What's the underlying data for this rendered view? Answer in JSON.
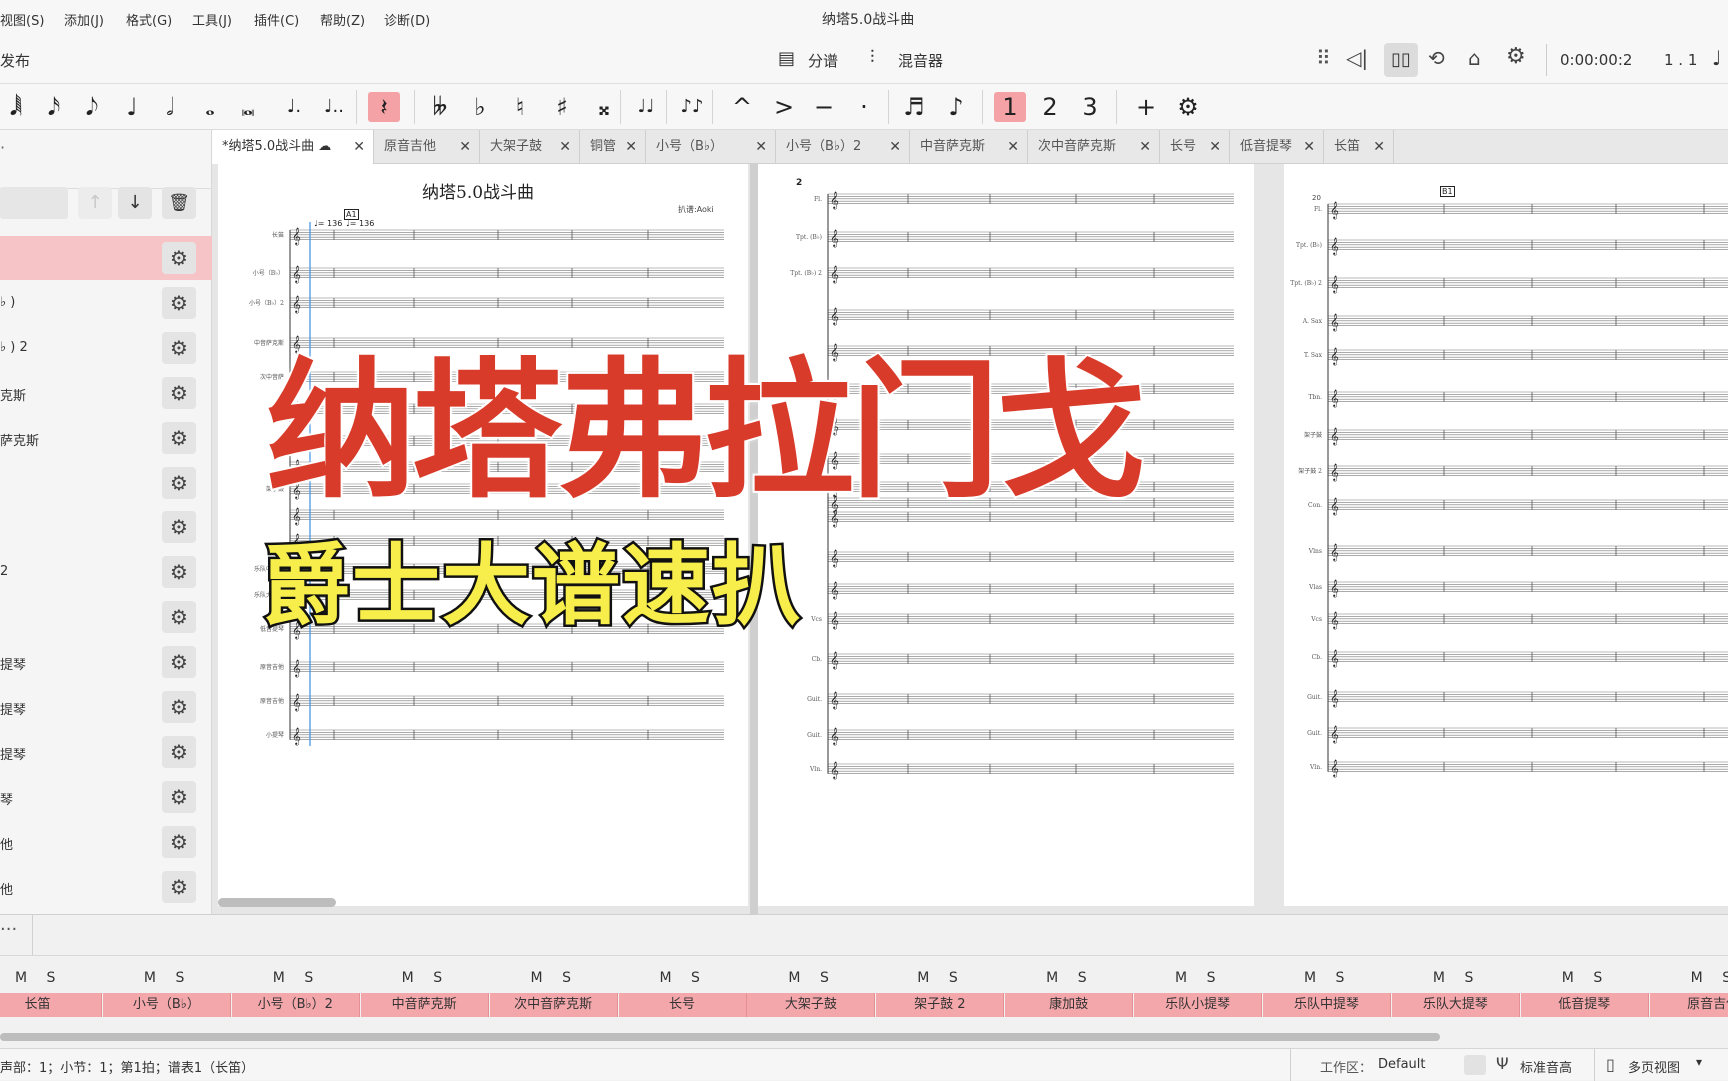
{
  "menu": [
    "视图(S)",
    "添加(J)",
    "格式(G)",
    "工具(J)",
    "插件(C)",
    "帮助(Z)",
    "诊断(D)"
  ],
  "window_title": "纳塔5.0战斗曲",
  "topbar": {
    "publish": "发布",
    "parts_label": "分谱",
    "mixer_label": "混音器",
    "time": "0:00:00:2",
    "position": "1 . 1"
  },
  "toolbar_icons": [
    "sixtyfourth-note-icon",
    "sixteenth-note-icon",
    "eighth-note-icon",
    "quarter-note-icon",
    "half-note-icon",
    "whole-note-icon",
    "breve-icon",
    "dotted-note-icon",
    "double-dotted-note-icon",
    "rest-icon",
    "double-flat-icon",
    "flat-icon",
    "natural-icon",
    "sharp-icon",
    "double-sharp-icon",
    "tie-icon",
    "slur-icon",
    "marcato-icon",
    "accent-icon",
    "tenuto-icon",
    "staccato-icon",
    "tuplet-icon",
    "flip-icon",
    "voice-1-icon",
    "voice-2-icon",
    "voice-3-icon",
    "add-icon",
    "toolbar-settings-icon"
  ],
  "toolbar_glyphs": [
    "𝅘𝅥𝅲",
    "𝅘𝅥𝅯",
    "𝅘𝅥𝅮",
    "♩",
    "𝅗𝅥",
    "𝅝",
    "𝅜",
    "♩.",
    "♩..",
    "𝄽",
    "𝄫",
    "♭",
    "♮",
    "♯",
    "𝄪",
    "♩♩",
    "♪♪",
    "^",
    ">",
    "−",
    "·",
    "♬",
    "♪",
    "1",
    "2",
    "3",
    "+",
    "⚙"
  ],
  "instrument_list": [
    {
      "label": ""
    },
    {
      "label": "♭ )"
    },
    {
      "label": "♭ ) 2"
    },
    {
      "label": "克斯"
    },
    {
      "label": "萨克斯"
    },
    {
      "label": ""
    },
    {
      "label": ""
    },
    {
      "label": "2"
    },
    {
      "label": ""
    },
    {
      "label": "提琴"
    },
    {
      "label": "提琴"
    },
    {
      "label": "提琴"
    },
    {
      "label": "琴"
    },
    {
      "label": "他"
    },
    {
      "label": "他"
    }
  ],
  "tabs": [
    {
      "label": "*纳塔5.0战斗曲",
      "cloud": "☁"
    },
    {
      "label": "原音吉他"
    },
    {
      "label": "大架子鼓"
    },
    {
      "label": "铜管"
    },
    {
      "label": "小号（B♭）"
    },
    {
      "label": "小号（B♭）2"
    },
    {
      "label": "中音萨克斯"
    },
    {
      "label": "次中音萨克斯"
    },
    {
      "label": "长号"
    },
    {
      "label": "低音提琴"
    },
    {
      "label": "长笛"
    }
  ],
  "score": {
    "title": "纳塔5.0战斗曲",
    "composer": "扒谱:Aoki",
    "tempo": "♩= 136",
    "tempo2": "♩= 136",
    "rehearsal_a": "A1",
    "rehearsal_b": "B1",
    "page2_number": "2",
    "page3_measure": "20",
    "page1_staff_labels": [
      "长笛",
      "小号（B♭）",
      "小号（B♭）2",
      "中音萨克斯",
      "次中音萨",
      "",
      "",
      "",
      "架子鼓",
      "",
      "",
      "乐队中提琴",
      "乐队大提琴",
      "低音提琴",
      "原音吉他",
      "原音吉他",
      "小提琴"
    ],
    "page2_staff_labels": [
      "Fl.",
      "Tpt. (B♭)",
      "Tpt. (B♭) 2",
      "",
      "",
      "",
      "",
      "",
      "",
      "",
      "",
      "",
      "",
      "Vcs",
      "Cb.",
      "Guit.",
      "Guit.",
      "Vln."
    ],
    "page3_staff_labels": [
      "Fl.",
      "Tpt. (B♭)",
      "Tpt. (B♭) 2",
      "A. Sax",
      "T. Sax",
      "Tbn.",
      "架子鼓",
      "架子鼓 2",
      "Con.",
      "Vlns",
      "Vlas",
      "Vcs",
      "Cb.",
      "Guit.",
      "Guit.",
      "Vln."
    ]
  },
  "overlay": {
    "title": "纳塔弗拉门戈",
    "subtitle": "爵士大谱速扒",
    "title_color": "#d93b2b",
    "subtitle_color": "#f7ee4b"
  },
  "mixer": {
    "more": "···",
    "mute": "M",
    "solo": "S",
    "channels": [
      "长笛",
      "小号（B♭）",
      "小号（B♭）2",
      "中音萨克斯",
      "次中音萨克斯",
      "长号",
      "大架子鼓",
      "架子鼓 2",
      "康加鼓",
      "乐队小提琴",
      "乐队中提琴",
      "乐队大提琴",
      "低音提琴",
      "原音吉他"
    ]
  },
  "status": {
    "text": "声部：1；小节：1；第1拍；谱表1（长笛）",
    "workspace_label": "工作区：",
    "workspace_value": "Default",
    "concert_pitch": "标准音高",
    "view_mode": "多页视图"
  },
  "colors": {
    "accent": "#f4a7ab",
    "selected_row": "#f6c4c6"
  }
}
